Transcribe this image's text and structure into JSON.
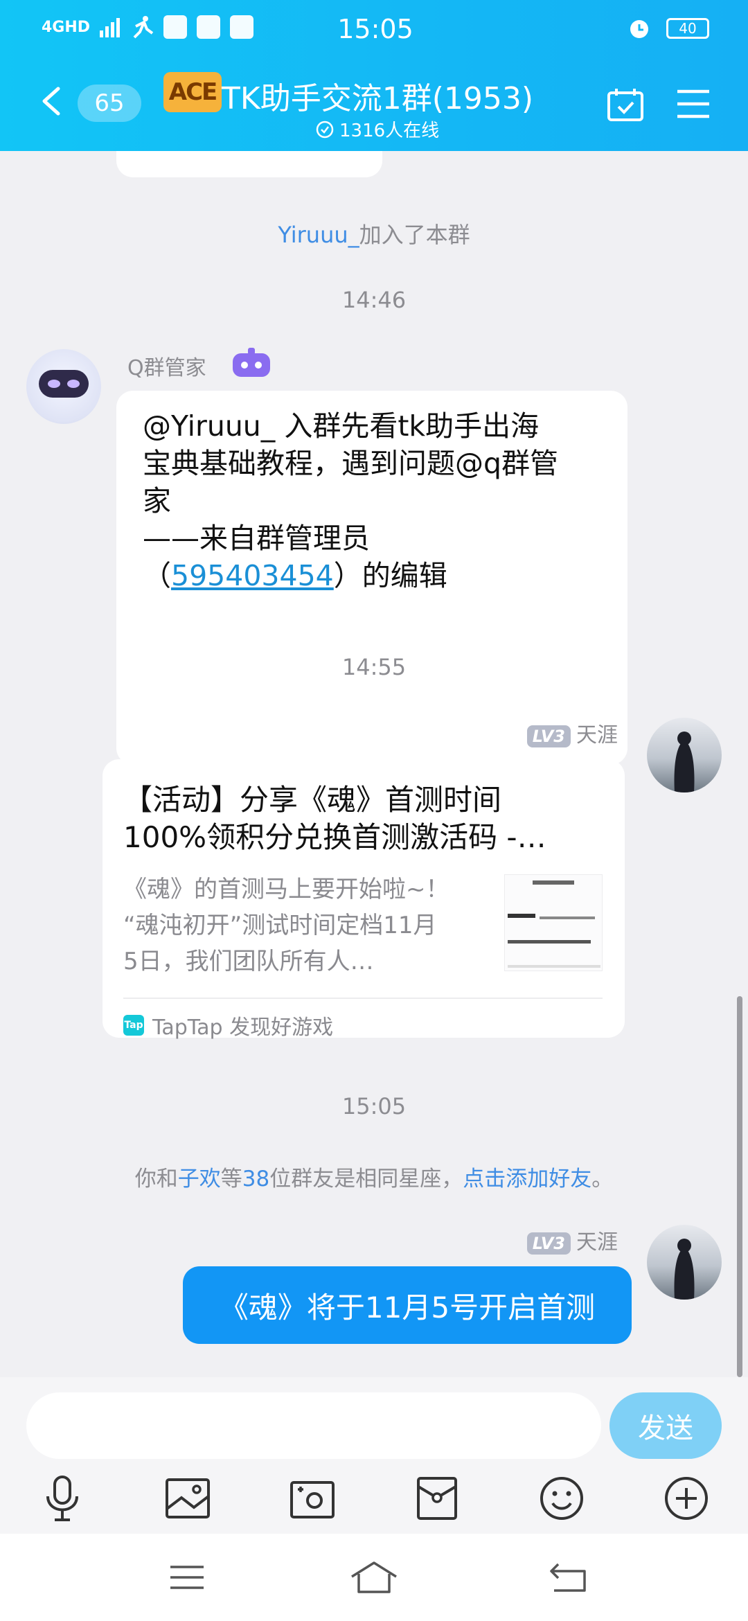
{
  "status_bar": {
    "time": "15:05",
    "network": "4GHD",
    "battery": "40"
  },
  "header": {
    "unread_count": "65",
    "group_logo_text": "ACE",
    "title": "TK助手交流1群(1953)",
    "online": "1316人在线"
  },
  "messages": {
    "join_notice": {
      "user": "Yiruuu_",
      "text": "加入了本群"
    },
    "time1": "14:46",
    "bot": {
      "name": "Q群管家",
      "line1": "@Yiruuu_ 入群先看tk助手出海",
      "line2": "宝典基础教程，遇到问题@q群管",
      "line3": "家",
      "line4": "——来自群管理员",
      "line5_prefix": "（",
      "line5_link": "595403454",
      "line5_suffix": "）的编辑"
    },
    "time2": "14:55",
    "card_msg": {
      "level": "LV3",
      "name": "天涯",
      "title_line1": "【活动】分享《魂》首测时间",
      "title_line2": "100%领积分兑换首测激活码 -…",
      "desc_line1": "《魂》的首测马上要开始啦~！",
      "desc_line2": "“魂沌初开”测试时间定档11月",
      "desc_line3": "5日，我们团队所有人…",
      "source_icon": "Tap",
      "source": "TapTap 发现好游戏"
    },
    "time3": "15:05",
    "zodiac": {
      "p1": "你和",
      "friend": "子欢",
      "p2": "等",
      "count": "38",
      "p3": "位群友是相同星座，",
      "action": "点击添加好友",
      "p4": "。"
    },
    "my_msg": {
      "level": "LV3",
      "name": "天涯",
      "text": "《魂》将于11月5号开启首测"
    }
  },
  "input": {
    "placeholder": "",
    "send_label": "发送"
  },
  "tools": [
    "microphone-icon",
    "image-icon",
    "camera-icon",
    "red-packet-icon",
    "emoji-icon",
    "plus-icon"
  ],
  "colors": {
    "header": "#14b8f5",
    "accent": "#1296f5",
    "link": "#3f8de4",
    "send_disabled": "#7fd0f6"
  }
}
